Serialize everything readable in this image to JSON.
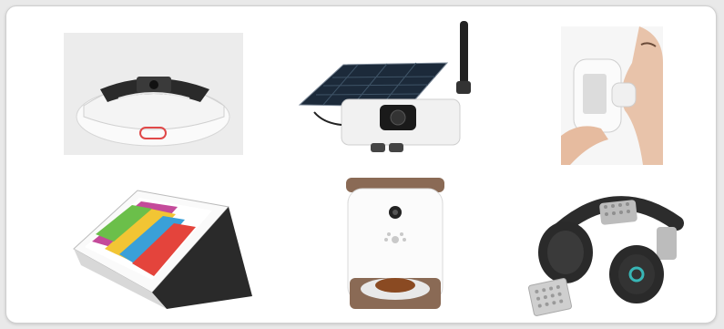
{
  "products": [
    {
      "id": "smoke-detector",
      "icon": "smoke-detector-icon"
    },
    {
      "id": "solar-camera",
      "icon": "solar-security-camera-icon"
    },
    {
      "id": "breath-analyzer",
      "icon": "handheld-breath-analyzer-icon"
    },
    {
      "id": "e-paper-tablet",
      "icon": "folding-tablet-stand-icon"
    },
    {
      "id": "pet-feeder",
      "icon": "smart-pet-feeder-icon"
    },
    {
      "id": "neck-headphones",
      "icon": "wearable-headphones-icon"
    }
  ],
  "colors": {
    "card_background": "#ffffff",
    "card_border": "#cfcfcf",
    "page_background": "#e9e9e9",
    "feeder_accent": "#8a6a55",
    "indicator_red": "#e04848",
    "indicator_teal": "#38b6b6"
  }
}
